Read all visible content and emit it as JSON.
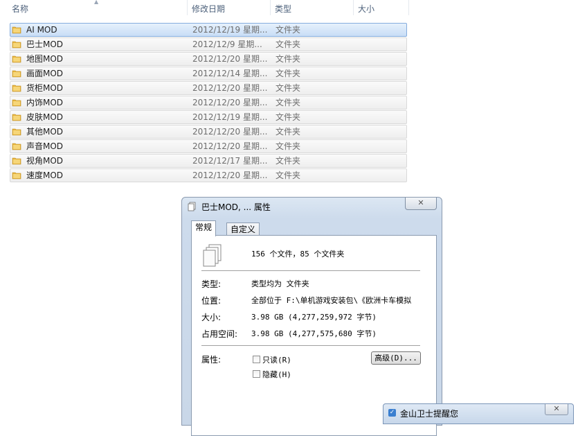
{
  "columns": {
    "name": "名称",
    "date": "修改日期",
    "type": "类型",
    "size": "大小"
  },
  "files": [
    {
      "name": "AI MOD",
      "date": "2012/12/19 星期...",
      "type": "文件夹",
      "selected": true
    },
    {
      "name": "巴士MOD",
      "date": "2012/12/9 星期...",
      "type": "文件夹"
    },
    {
      "name": "地图MOD",
      "date": "2012/12/20 星期...",
      "type": "文件夹"
    },
    {
      "name": "画面MOD",
      "date": "2012/12/14 星期...",
      "type": "文件夹"
    },
    {
      "name": "货柜MOD",
      "date": "2012/12/20 星期...",
      "type": "文件夹"
    },
    {
      "name": "内饰MOD",
      "date": "2012/12/20 星期...",
      "type": "文件夹"
    },
    {
      "name": "皮肤MOD",
      "date": "2012/12/19 星期...",
      "type": "文件夹"
    },
    {
      "name": "其他MOD",
      "date": "2012/12/20 星期...",
      "type": "文件夹"
    },
    {
      "name": "声音MOD",
      "date": "2012/12/20 星期...",
      "type": "文件夹"
    },
    {
      "name": "视角MOD",
      "date": "2012/12/17 星期...",
      "type": "文件夹"
    },
    {
      "name": "速度MOD",
      "date": "2012/12/20 星期...",
      "type": "文件夹"
    }
  ],
  "dialog": {
    "title": "巴士MOD, ... 属性",
    "close": "✕",
    "tabs": [
      "常规",
      "自定义"
    ],
    "summary": "156 个文件，85 个文件夹",
    "type_label": "类型:",
    "type_value": "类型均为 文件夹",
    "location_label": "位置:",
    "location_value": "全部位于 F:\\单机游戏安装包\\《欧洲卡车模拟",
    "size_label": "大小:",
    "size_value": "3.98 GB (4,277,259,972 字节)",
    "disk_label": "占用空间:",
    "disk_value": "3.98 GB (4,277,575,680 字节)",
    "attr_label": "属性:",
    "readonly_label": "只读(R)",
    "hidden_label": "隐藏(H)",
    "advanced_label": "高级(D)..."
  },
  "notification": {
    "title": "金山卫士提醒您",
    "close": "✕"
  },
  "colors": {
    "selection": "#cce2f8",
    "folder": "#e9b43c",
    "header_text": "#4c607a"
  }
}
